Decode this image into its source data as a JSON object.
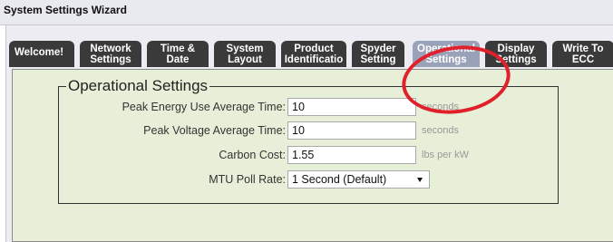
{
  "window": {
    "title": "System Settings Wizard"
  },
  "tabs": [
    {
      "id": "welcome",
      "line1": "Welcome!",
      "line2": ""
    },
    {
      "id": "network",
      "line1": "Network",
      "line2": "Settings"
    },
    {
      "id": "time",
      "line1": "Time &",
      "line2": "Date"
    },
    {
      "id": "layout",
      "line1": "System",
      "line2": "Layout"
    },
    {
      "id": "product",
      "line1": "Product",
      "line2": "Identificatio"
    },
    {
      "id": "spyder",
      "line1": "Spyder",
      "line2": "Setting"
    },
    {
      "id": "operational",
      "line1": "Operational",
      "line2": "Settings"
    },
    {
      "id": "display",
      "line1": "Display",
      "line2": "Settings"
    },
    {
      "id": "write",
      "line1": "Write To",
      "line2": "ECC"
    }
  ],
  "active_tab": "Operational Settings",
  "form": {
    "legend": "Operational Settings",
    "fields": [
      {
        "label": "Peak Energy Use Average Time:",
        "value": "10",
        "unit": "seconds"
      },
      {
        "label": "Peak Voltage Average Time:",
        "value": "10",
        "unit": "seconds"
      },
      {
        "label": "Carbon Cost:",
        "value": "1.55",
        "unit": "lbs per kW"
      }
    ],
    "poll": {
      "label": "MTU Poll Rate:",
      "selected": "1 Second (Default)"
    }
  },
  "colors": {
    "tab_dark": "#3a3a3a",
    "tab_active": "#9aa2ba",
    "panel_bg": "#e8efd9",
    "annotation_ring": "#e0202a"
  }
}
